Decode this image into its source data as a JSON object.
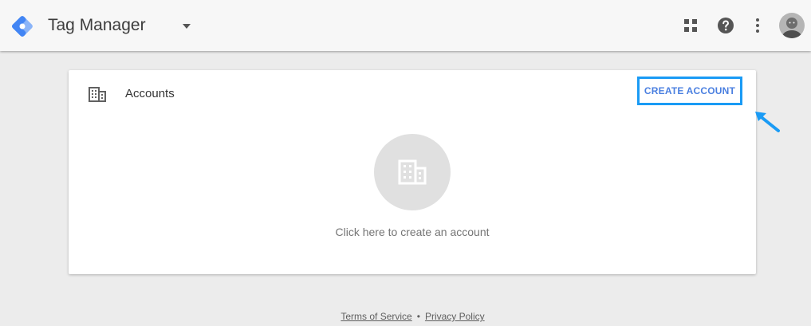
{
  "header": {
    "app_title": "Tag Manager",
    "icons": [
      "tag-manager-logo-icon",
      "dropdown-caret-icon",
      "apps-grid-icon",
      "help-icon",
      "more-vert-icon",
      "avatar"
    ]
  },
  "accounts_card": {
    "title": "Accounts",
    "create_button_label": "CREATE ACCOUNT",
    "empty_state_text": "Click here to create an account"
  },
  "footer": {
    "terms_label": "Terms of Service",
    "separator": "•",
    "privacy_label": "Privacy Policy"
  },
  "colors": {
    "accent_blue": "#4a7fe0",
    "highlight_border": "#1a9bf5",
    "background": "#ececec"
  }
}
